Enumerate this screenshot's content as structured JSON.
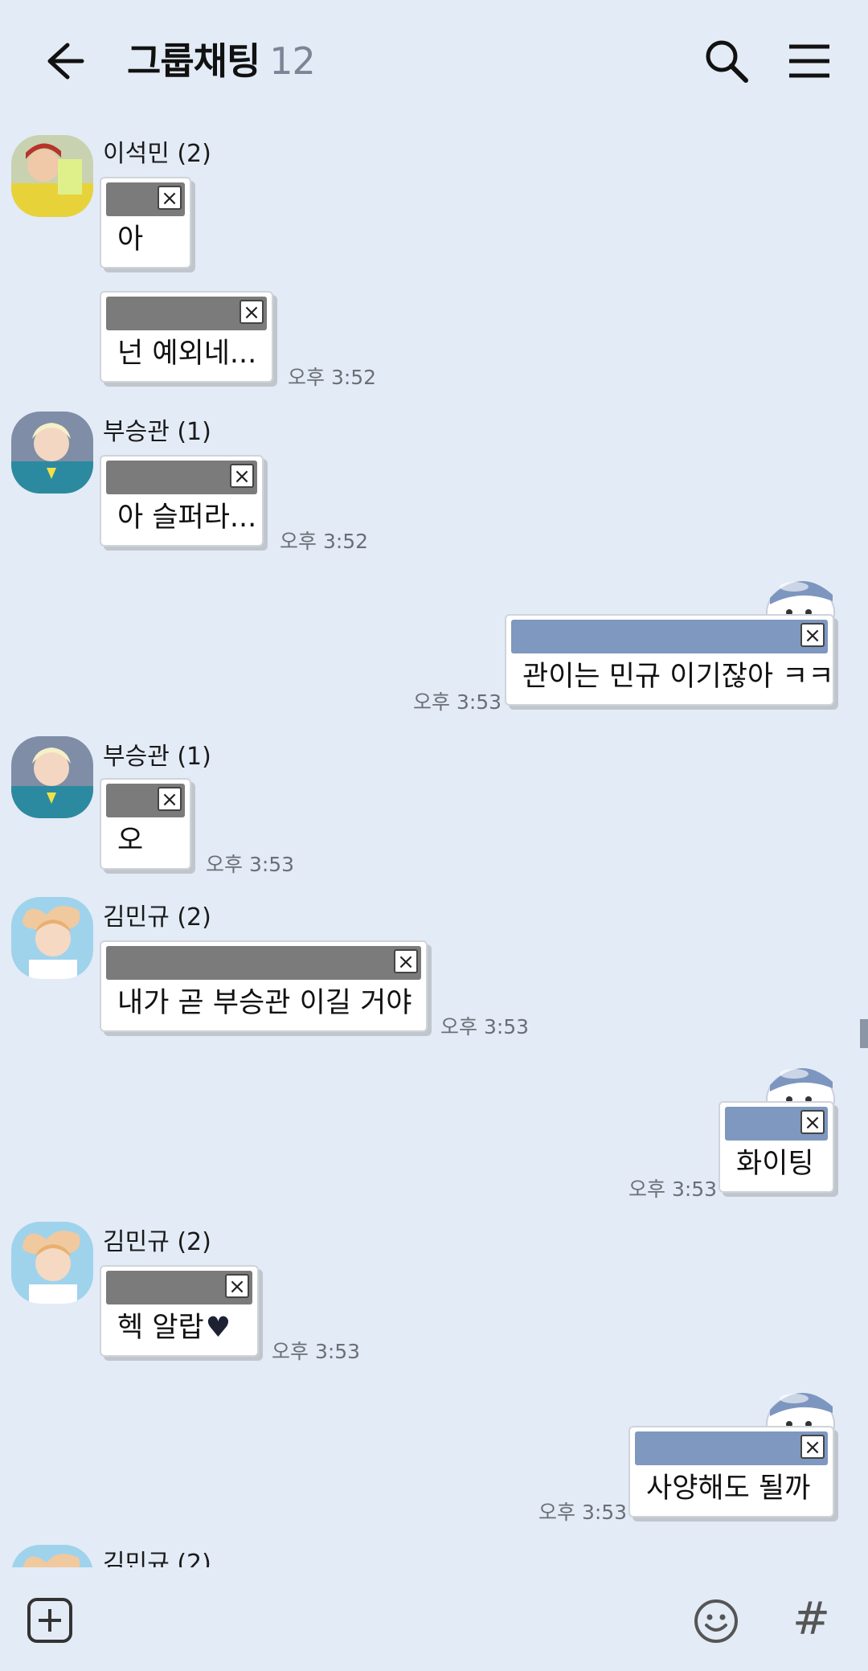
{
  "header": {
    "title": "그룹채팅",
    "member_count": "12"
  },
  "messages": [
    {
      "sender": "이석민 (2)",
      "text": "아",
      "time": ""
    },
    {
      "sender": "",
      "text": "넌 예외네...",
      "time": "오후 3:52"
    },
    {
      "sender": "부승관 (1)",
      "text": "아 슬퍼라...",
      "time": "오후 3:52"
    },
    {
      "sender": "",
      "text": "관이는 민규 이기잖아 ㅋㅋ",
      "time": "오후 3:53",
      "mine": true
    },
    {
      "sender": "부승관 (1)",
      "text": "오",
      "time": "오후 3:53"
    },
    {
      "sender": "김민규 (2)",
      "text": "내가 곧 부승관 이길 거야",
      "time": "오후 3:53"
    },
    {
      "sender": "",
      "text": "화이팅",
      "time": "오후 3:53",
      "mine": true
    },
    {
      "sender": "김민규 (2)",
      "text": "헥 알랍",
      "time": "오후 3:53"
    },
    {
      "sender": "",
      "text": "사양해도 될까",
      "time": "오후 3:53",
      "mine": true
    },
    {
      "sender": "김민규 (2)",
      "text": "",
      "time": ""
    }
  ],
  "close_glyph": "×",
  "heart_glyph": "♥",
  "input_bar": {
    "hash_label": "#"
  },
  "colors": {
    "background": "#e3ebf6",
    "sticker_bar_other": "#7b7b7b",
    "sticker_bar_mine": "#7e98bf"
  }
}
